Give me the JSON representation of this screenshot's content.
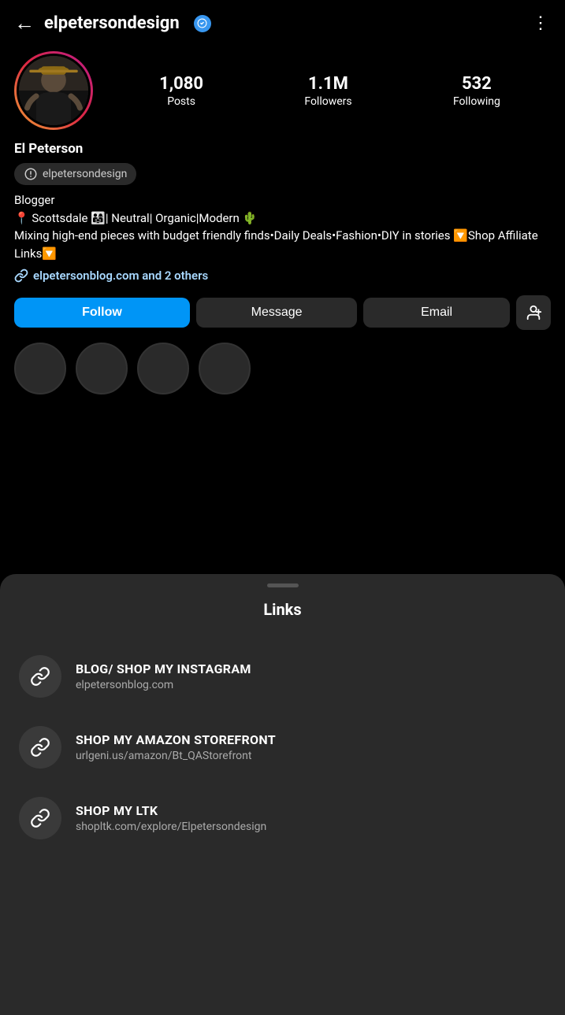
{
  "header": {
    "username": "elpetersondesign",
    "back_label": "←",
    "more_label": "⋮"
  },
  "profile": {
    "display_name": "El Peterson",
    "threads_handle": "elpetersondesign",
    "bio_line1": "Blogger",
    "bio_line2": "📍 Scottsdale 👨‍👩‍👧| Neutral| Organic|Modern 🌵",
    "bio_line3": "Mixing high-end pieces with budget friendly finds•Daily Deals•Fashion•DIY in stories 🔽Shop Affiliate Links🔽",
    "link_text": "elpetersonblog.com and 2 others"
  },
  "stats": {
    "posts_count": "1,080",
    "posts_label": "Posts",
    "followers_count": "1.1M",
    "followers_label": "Followers",
    "following_count": "532",
    "following_label": "Following"
  },
  "buttons": {
    "follow_label": "Follow",
    "message_label": "Message",
    "email_label": "Email"
  },
  "links_sheet": {
    "title": "Links",
    "items": [
      {
        "title": "BLOG/ SHOP MY INSTAGRAM",
        "url": "elpetersonblog.com"
      },
      {
        "title": "SHOP MY AMAZON STOREFRONT",
        "url": "urlgeni.us/amazon/Bt_QAStorefront"
      },
      {
        "title": "SHOP MY LTK",
        "url": "shopltk.com/explore/Elpetersondesign"
      }
    ]
  }
}
